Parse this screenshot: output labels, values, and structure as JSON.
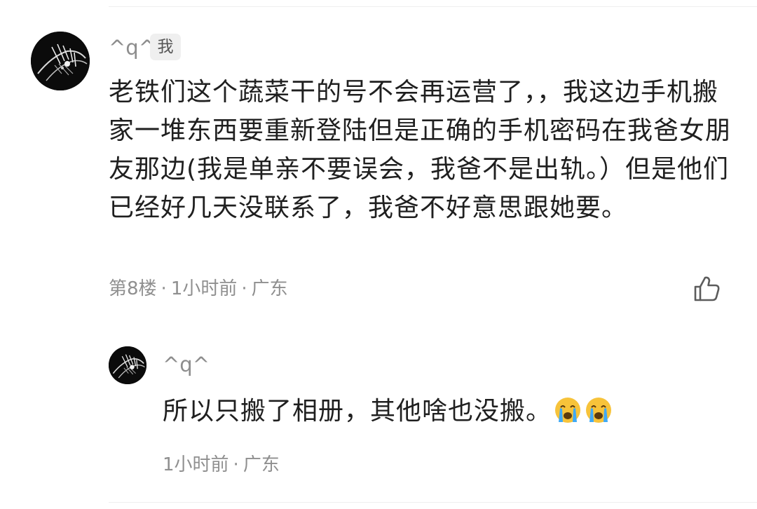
{
  "comment": {
    "username": "^q^",
    "me_badge": "我",
    "text": "老铁们这个蔬菜干的号不会再运营了，，我这边手机搬家一堆东西要重新登陆但是正确的手机密码在我爸女朋友那边(我是单亲不要误会，我爸不是出轨。）但是他们已经好几天没联系了，我爸不好意思跟她要。",
    "floor": "第8楼",
    "time": "1小时前",
    "location": "广东",
    "separator": "·",
    "like_icon": "thumbs-up-icon"
  },
  "reply": {
    "username": "^q^",
    "text": "所以只搬了相册，其他啥也没搬。",
    "emojis": [
      "loudly-crying-face",
      "loudly-crying-face"
    ],
    "time": "1小时前",
    "location": "广东",
    "separator": "·"
  },
  "colors": {
    "text_primary": "#1f1f1f",
    "text_secondary": "#8d8d8d",
    "badge_bg": "#efefef",
    "emoji_face": "#f7c33a",
    "emoji_tear": "#3fa9f5"
  }
}
